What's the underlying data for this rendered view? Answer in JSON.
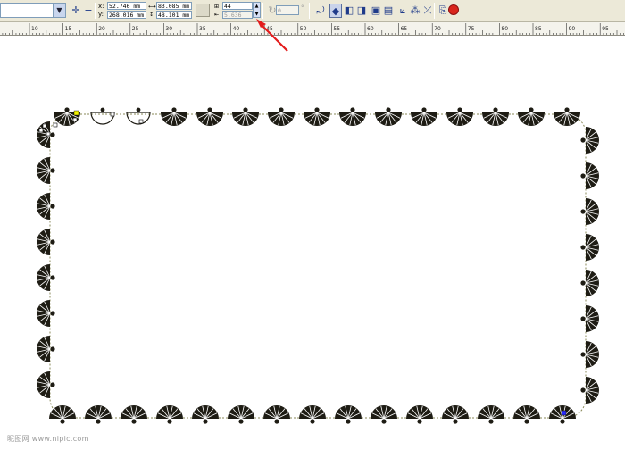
{
  "toolbar": {
    "x_label": "x:",
    "y_label": "y:",
    "x_value": "52.746 mm",
    "y_value": "268.016 mm",
    "width_value": "83.085 mm",
    "height_value": "48.101 mm",
    "count_value": "44",
    "spacing_value": "5.636",
    "angle_value": "0",
    "degree_symbol": "°"
  },
  "ruler": {
    "labels": [
      "10",
      "15",
      "20",
      "25",
      "30",
      "35",
      "40",
      "45",
      "50",
      "55",
      "60",
      "65",
      "70",
      "75",
      "80",
      "85",
      "90",
      "95"
    ]
  },
  "watermark": {
    "text": "昵图网 www.nipic.com"
  },
  "colors": {
    "ornament": "#1e1c14",
    "path": "#8a8a5a",
    "arrow": "#e31b1b",
    "selected_node": "#f0f000",
    "end_node": "#2a2aff"
  }
}
